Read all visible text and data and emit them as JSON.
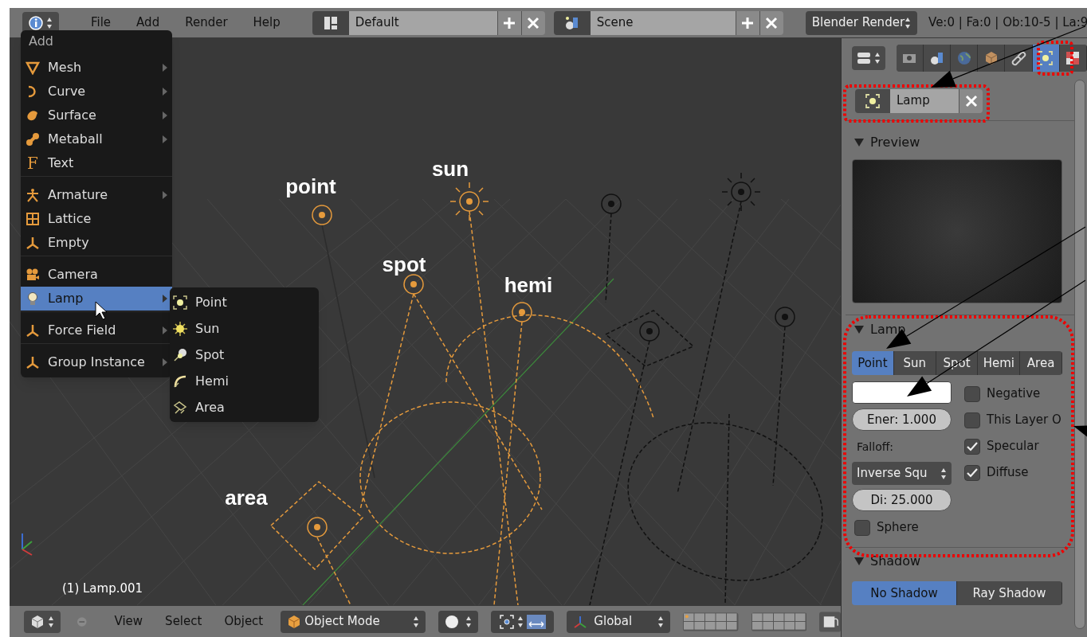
{
  "header": {
    "menus": [
      "File",
      "Add",
      "Render",
      "Help"
    ],
    "screen_layout": "Default",
    "scene": "Scene",
    "render_engine": "Blender Render",
    "stats": "Ve:0 | Fa:0 | Ob:10-5 | La:9"
  },
  "add_menu": {
    "title": "Add",
    "sections": [
      [
        {
          "label": "Mesh",
          "kind": "mesh",
          "submenu": true,
          "selected": false
        },
        {
          "label": "Curve",
          "kind": "curve",
          "submenu": true,
          "selected": false
        },
        {
          "label": "Surface",
          "kind": "surface",
          "submenu": true,
          "selected": false
        },
        {
          "label": "Metaball",
          "kind": "metaball",
          "submenu": true,
          "selected": false
        },
        {
          "label": "Text",
          "kind": "text",
          "glyph": "F",
          "submenu": false,
          "selected": false
        }
      ],
      [
        {
          "label": "Armature",
          "kind": "armature",
          "submenu": true,
          "selected": false
        },
        {
          "label": "Lattice",
          "kind": "lattice",
          "submenu": false,
          "selected": false
        },
        {
          "label": "Empty",
          "kind": "empty",
          "submenu": false,
          "selected": false
        }
      ],
      [
        {
          "label": "Camera",
          "kind": "camera",
          "submenu": false,
          "selected": false
        },
        {
          "label": "Lamp",
          "kind": "bulb",
          "submenu": true,
          "selected": true
        }
      ],
      [
        {
          "label": "Force Field",
          "kind": "empty",
          "submenu": true,
          "selected": false
        }
      ],
      [
        {
          "label": "Group Instance",
          "kind": "empty",
          "submenu": true,
          "selected": false
        }
      ]
    ]
  },
  "lamp_submenu": [
    {
      "label": "Point",
      "kind": "point"
    },
    {
      "label": "Sun",
      "kind": "sun"
    },
    {
      "label": "Spot",
      "kind": "spot"
    },
    {
      "label": "Hemi",
      "kind": "hemi"
    },
    {
      "label": "Area",
      "kind": "area"
    }
  ],
  "viewport": {
    "lamp_labels": [
      "point",
      "sun",
      "spot",
      "hemi",
      "area"
    ],
    "object_info": "(1) Lamp.001"
  },
  "properties": {
    "tabs": [
      {
        "kind": "camera",
        "selected": false
      },
      {
        "kind": "scene",
        "selected": false
      },
      {
        "kind": "world",
        "selected": false
      },
      {
        "kind": "cube",
        "selected": false
      },
      {
        "kind": "link",
        "selected": false
      },
      {
        "kind": "lamp",
        "selected": true
      },
      {
        "kind": "checker",
        "selected": false
      }
    ],
    "datablock": "Lamp",
    "preview_title": "Preview",
    "lamp_panel": {
      "title": "Lamp",
      "types": [
        {
          "label": "Point",
          "selected": true
        },
        {
          "label": "Sun",
          "selected": false
        },
        {
          "label": "Spot",
          "selected": false
        },
        {
          "label": "Hemi",
          "selected": false
        },
        {
          "label": "Area",
          "selected": false
        }
      ],
      "energy": "Ener: 1.000",
      "falloff_label": "Falloff:",
      "falloff": "Inverse Squ",
      "distance": "Di: 25.000",
      "sphere": {
        "label": "Sphere",
        "checked": false
      },
      "options": [
        {
          "label": "Negative",
          "checked": false
        },
        {
          "label": "This Layer O",
          "checked": false
        },
        {
          "label": "Specular",
          "checked": true
        },
        {
          "label": "Diffuse",
          "checked": true
        }
      ]
    },
    "shadow_panel": {
      "title": "Shadow",
      "modes": [
        {
          "label": "No Shadow",
          "selected": true
        },
        {
          "label": "Ray Shadow",
          "selected": false
        }
      ]
    }
  },
  "bottom_bar": {
    "menus": [
      "View",
      "Select",
      "Object"
    ],
    "mode": "Object Mode",
    "orientation": "Global"
  }
}
